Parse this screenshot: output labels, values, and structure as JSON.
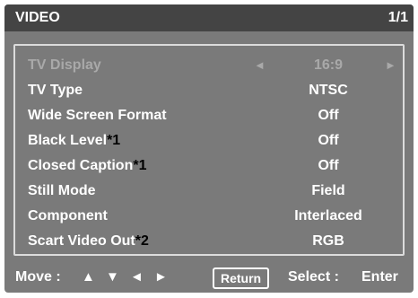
{
  "title_bar": {
    "title": "VIDEO",
    "page": "1/1"
  },
  "colors": {
    "background": "#7a7a7a",
    "title_bar": "#444444",
    "text": "#ffffff",
    "disabled_text": "#a9a9a9",
    "footnote_marker": "#000000"
  },
  "menu": {
    "items": [
      {
        "label": "TV Display",
        "note": "",
        "value": "16:9",
        "disabled": true,
        "arrows": true
      },
      {
        "label": "TV Type",
        "note": "",
        "value": "NTSC",
        "disabled": false
      },
      {
        "label": "Wide Screen Format",
        "note": "",
        "value": "Off",
        "disabled": false
      },
      {
        "label": "Black Level",
        "note": "*1",
        "value": "Off",
        "disabled": false
      },
      {
        "label": "Closed Caption",
        "note": "*1",
        "value": "Off",
        "disabled": false
      },
      {
        "label": "Still Mode",
        "note": "",
        "value": "Field",
        "disabled": false
      },
      {
        "label": "Component",
        "note": "",
        "value": "Interlaced",
        "disabled": false
      },
      {
        "label": "Scart Video Out",
        "note": "*2",
        "value": "RGB",
        "disabled": false
      }
    ],
    "left_arrow_icon": "◄",
    "right_arrow_icon": "►"
  },
  "footer": {
    "move_label": "Move :",
    "nav_arrows": "▲ ▼ ◄ ►",
    "return_label": "Return",
    "select_label": "Select :",
    "select_key": "Enter"
  }
}
